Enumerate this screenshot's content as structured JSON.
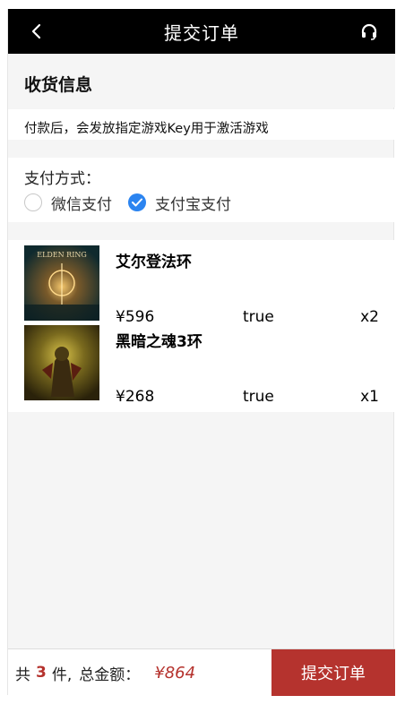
{
  "header": {
    "title": "提交订单",
    "back_icon": "chevron-left-icon",
    "service_icon": "headset-icon"
  },
  "section_title": "收货信息",
  "notice": "付款后，会发放指定游戏Key用于激活游戏",
  "payment": {
    "label": "支付方式：",
    "options": [
      {
        "label": "微信支付",
        "selected": false
      },
      {
        "label": "支付宝支付",
        "selected": true
      }
    ],
    "selected_color": "#2b84f0"
  },
  "items": [
    {
      "name": "艾尔登法环",
      "price": "¥596",
      "flag": "true",
      "qty": "x2",
      "cover_text": "ELDEN RING"
    },
    {
      "name": "黑暗之魂3环",
      "price": "¥268",
      "flag": "true",
      "qty": "x1"
    }
  ],
  "footer": {
    "prefix": "共",
    "count": "3",
    "suffix": "件,",
    "total_label": "总金额：",
    "total": "¥864",
    "submit_label": "提交订单"
  },
  "colors": {
    "accent": "#b5332e",
    "header_bg": "#000000"
  }
}
